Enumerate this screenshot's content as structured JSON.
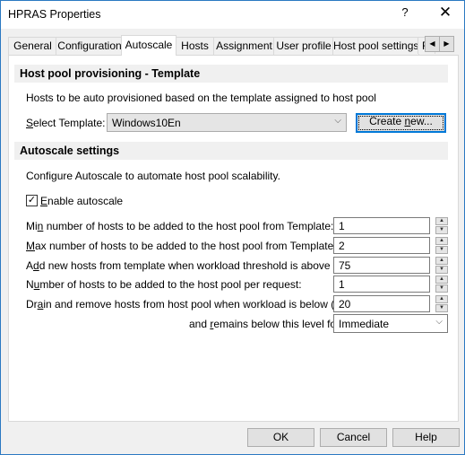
{
  "window": {
    "title": "HPRAS Properties",
    "help_glyph": "?",
    "close_glyph": "✕"
  },
  "tabs": [
    {
      "label": "General",
      "active": false
    },
    {
      "label": "Configuration",
      "active": false
    },
    {
      "label": "Autoscale",
      "active": true
    },
    {
      "label": "Hosts",
      "active": false
    },
    {
      "label": "Assignment",
      "active": false
    },
    {
      "label": "User profile",
      "active": false
    },
    {
      "label": "Host pool settings",
      "active": false
    },
    {
      "label": "R",
      "active": false
    }
  ],
  "tab_scroll": {
    "left": "◀",
    "right": "▶"
  },
  "template_section": {
    "heading": "Host pool provisioning - Template",
    "description": "Hosts to be auto provisioned based on the template assigned to host pool",
    "select_label_pre": "",
    "select_label_accel": "S",
    "select_label_post": "elect Template:",
    "selected_template": "Windows10En",
    "create_new_pre": "Create ",
    "create_new_accel": "n",
    "create_new_post": "ew..."
  },
  "autoscale_section": {
    "heading": "Autoscale settings",
    "description": "Configure Autoscale to automate host pool scalability.",
    "enable_checkbox": {
      "checked": true,
      "check_glyph": "✓",
      "label_accel": "E",
      "label_post": "nable autoscale"
    },
    "settings": [
      {
        "pre": "Mi",
        "accel": "n",
        "post": " number of hosts to be added to the host pool from Template:",
        "value": "1"
      },
      {
        "pre": "",
        "accel": "M",
        "post": "ax number of hosts to be added to the host pool from Template:",
        "value": "2"
      },
      {
        "pre": "A",
        "accel": "d",
        "post": "d new hosts from template when workload threshold is above (%):",
        "value": "75"
      },
      {
        "pre": "N",
        "accel": "u",
        "post": "mber of hosts to be added to the host pool per request:",
        "value": "1"
      },
      {
        "pre": "Dr",
        "accel": "a",
        "post": "in and remove hosts from host pool when workload is below (%):",
        "value": "20"
      }
    ],
    "remains": {
      "pre": "and ",
      "accel": "r",
      "post": "emains below this level for",
      "value": "Immediate"
    }
  },
  "spin_glyphs": {
    "up": "▲",
    "down": "▼"
  },
  "chevron_glyph": "⌵",
  "footer": {
    "ok": "OK",
    "cancel": "Cancel",
    "help": "Help"
  }
}
